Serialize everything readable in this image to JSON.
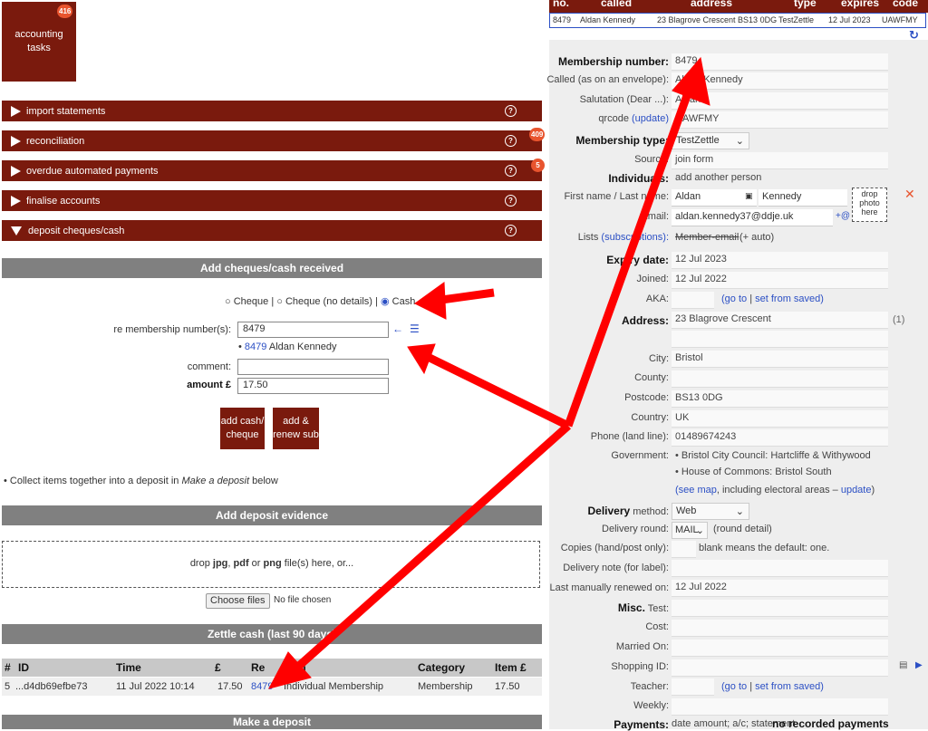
{
  "tile": {
    "label1": "accounting",
    "label2": "tasks",
    "badge": "416"
  },
  "bars": [
    {
      "label": "import statements",
      "badge": ""
    },
    {
      "label": "reconciliation",
      "badge": "409"
    },
    {
      "label": "overdue automated payments",
      "badge": "5"
    },
    {
      "label": "finalise accounts",
      "badge": ""
    },
    {
      "label": "deposit cheques/cash",
      "badge": ""
    }
  ],
  "add_cash": {
    "title": "Add cheques/cash received",
    "radio_cheque": "Cheque",
    "radio_sep1": "|",
    "radio_cheque_nd": "Cheque (no details)",
    "radio_sep2": "|",
    "radio_cash": "Cash",
    "membership_label": "re membership number(s):",
    "membership_value": "8479",
    "member_link_num": "8479",
    "member_name": "Aldan Kennedy",
    "comment_label": "comment:",
    "comment_value": "",
    "amount_label": "amount £",
    "amount_value": "17.50",
    "btn_add1": "add cash/",
    "btn_add2": "cheque",
    "btn_renew1": "add &",
    "btn_renew2": "renew sub",
    "note_pre": "• Collect items together into a deposit in ",
    "note_em": "Make a deposit",
    "note_post": " below"
  },
  "evidence": {
    "title": "Add deposit evidence",
    "drop_pre": "drop ",
    "jpg": "jpg",
    "comma": ", ",
    "pdf": "pdf",
    "or": " or ",
    "png": "png",
    "drop_post": " file(s) here, or...",
    "choose": "Choose files",
    "no_file": "No file chosen"
  },
  "zettle": {
    "title": "Zettle cash (last 90 days)",
    "headers": [
      "#",
      "ID",
      "Time",
      "£",
      "Re",
      "Item",
      "Category",
      "Item £"
    ],
    "row": {
      "n": "5",
      "id": "...d4db69efbe73",
      "time": "11 Jul 2022 10:14",
      "amount": "17.50",
      "re": "8479",
      "item": "Individual Membership",
      "category": "Membership",
      "item_amount": "17.50"
    }
  },
  "deposit": {
    "title": "Make a deposit"
  },
  "top_table": {
    "headers": [
      "no.",
      "called",
      "address",
      "type",
      "expires",
      "code"
    ],
    "row": {
      "no": "8479",
      "called": "Aldan Kennedy",
      "address": "23 Blagrove Crescent BS13 0DG",
      "type": "TestZettle",
      "expires": "12 Jul 2023",
      "code": "UAWFMY"
    }
  },
  "member": {
    "membership_number_label": "Membership number:",
    "membership_number": "8479",
    "called_label": "Called (as on an envelope):",
    "called": "Aldan Kennedy",
    "salutation_label": "Salutation (Dear ...):",
    "salutation": "Aldan",
    "qrcode_label": "qrcode",
    "qrcode_update": "(update)",
    "qrcode": "UAWFMY",
    "type_label": "Membership type:",
    "type": "TestZettle",
    "source_label": "Source:",
    "source": "join form",
    "individuals_label": "Individuals:",
    "add_person": "add another person",
    "name_label": "First name / Last name:",
    "first_name": "Aldan",
    "last_name": "Kennedy",
    "email_label": "Email:",
    "email": "aldan.kennedy37@ddje.uk",
    "email_plus": "+@",
    "drop_photo": "drop photo here",
    "lists_label": "Lists",
    "lists_sub": "(subscriptions):",
    "lists_member": "Member-email",
    "lists_auto": "(+ auto)",
    "expiry_label": "Expiry date:",
    "expiry": "12 Jul 2023",
    "joined_label": "Joined:",
    "joined": "12 Jul 2022",
    "aka_label": "AKA:",
    "goto": "(go to",
    "goto_sep": "|",
    "set_saved": "set from saved)",
    "address_label": "Address:",
    "address1": "23 Blagrove Crescent",
    "address_count": "(1)",
    "city_label": "City:",
    "city": "Bristol",
    "county_label": "County:",
    "postcode_label": "Postcode:",
    "postcode": "BS13 0DG",
    "country_label": "Country:",
    "country": "UK",
    "phone_label": "Phone (land line):",
    "phone": "01489674243",
    "government_label": "Government:",
    "gov1": "• Bristol City Council: Hartcliffe & Withywood",
    "gov2": "• House of Commons: Bristol South",
    "gov_map": "(see map",
    "gov_mid": ", including electoral areas – ",
    "gov_update": "update",
    "gov_end": ")",
    "delivery_label": "Delivery",
    "delivery_method_label": "method:",
    "delivery_method": "Web",
    "delivery_round_label": "Delivery round:",
    "delivery_round": "MAIL",
    "round_detail": "(round detail)",
    "copies_label": "Copies (hand/post only):",
    "copies_note": "blank means the default: one.",
    "delivery_note_label": "Delivery note (for label):",
    "last_renewed_label": "Last manually renewed on:",
    "last_renewed": "12 Jul 2022",
    "misc_label": "Misc.",
    "test_label": "Test:",
    "cost_label": "Cost:",
    "married_label": "Married On:",
    "shopping_label": "Shopping ID:",
    "teacher_label": "Teacher:",
    "weekly_label": "Weekly:",
    "payments_label": "Payments:",
    "payments_cols": "date   amount; a/c; statement",
    "payments_none": "no recorded payments"
  }
}
